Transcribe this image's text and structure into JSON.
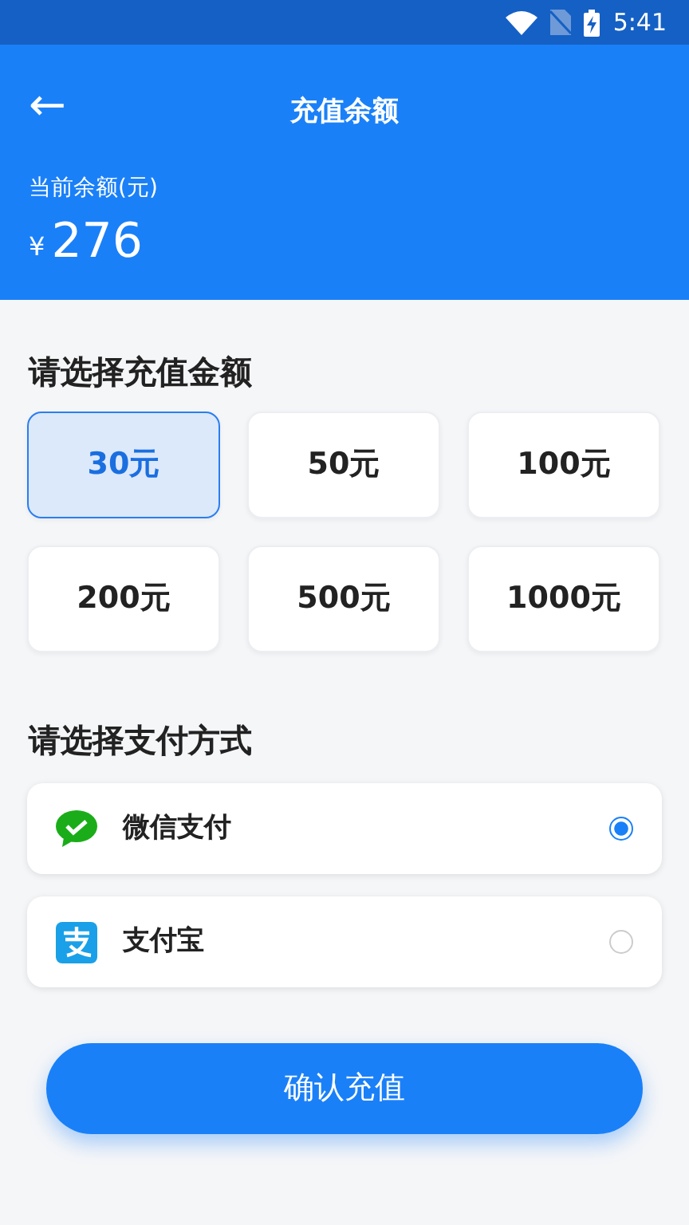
{
  "status_bar": {
    "time": "5:41"
  },
  "header": {
    "back": "←",
    "title": "充值余额",
    "balance_label": "当前余额(元)",
    "currency": "¥",
    "balance": "276"
  },
  "amount_section": {
    "title": "请选择充值金额",
    "options": [
      {
        "label": "30元",
        "selected": true
      },
      {
        "label": "50元",
        "selected": false
      },
      {
        "label": "100元",
        "selected": false
      },
      {
        "label": "200元",
        "selected": false
      },
      {
        "label": "500元",
        "selected": false
      },
      {
        "label": "1000元",
        "selected": false
      }
    ]
  },
  "payment_section": {
    "title": "请选择支付方式",
    "methods": [
      {
        "kind": "wechat",
        "label": "微信支付",
        "selected": true
      },
      {
        "kind": "alipay",
        "label": "支付宝",
        "selected": false
      }
    ]
  },
  "confirm_button": "确认充值"
}
